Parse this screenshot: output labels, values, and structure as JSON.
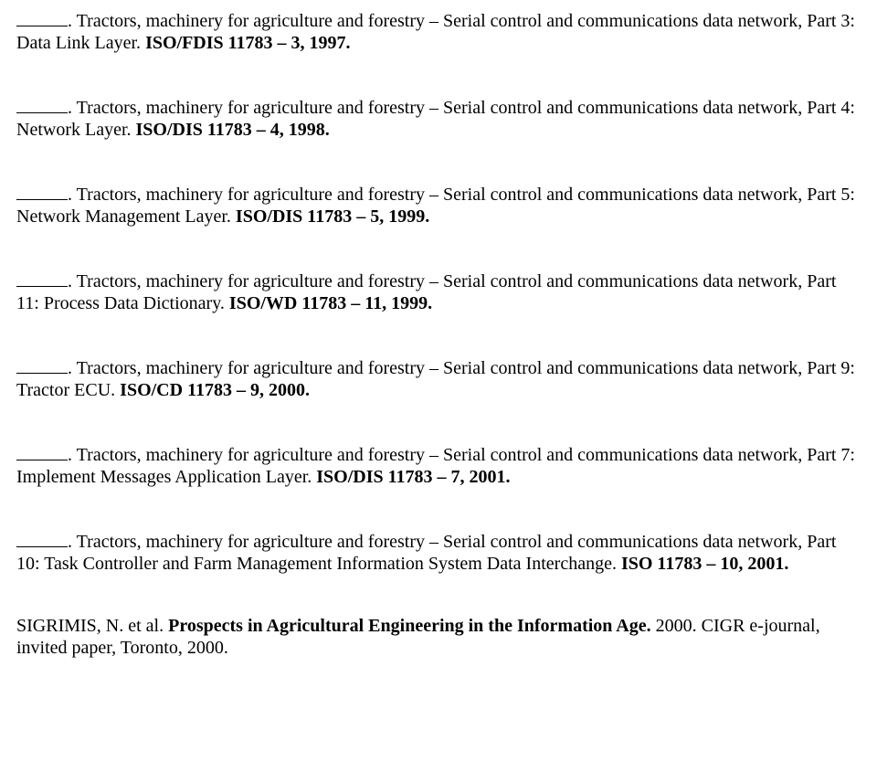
{
  "entries": [
    {
      "title": "Tractors, machinery for agriculture and forestry – Serial control and communications data network, Part 3: Data Link Layer.",
      "code": "ISO/FDIS 11783 – 3, 1997."
    },
    {
      "title": "Tractors, machinery for agriculture and forestry – Serial control and communications data network, Part 4: Network Layer.",
      "code": "ISO/DIS 11783 – 4, 1998."
    },
    {
      "title": "Tractors, machinery for agriculture and forestry – Serial control and communications data network,  Part 5: Network Management Layer.",
      "code": "ISO/DIS 11783 – 5, 1999."
    },
    {
      "title": "Tractors, machinery for agriculture and forestry – Serial control and communications data network, Part 11: Process Data Dictionary.",
      "code": "ISO/WD 11783 – 11, 1999."
    },
    {
      "title": "Tractors, machinery for agriculture and forestry – Serial control and communications data network,  Part 9: Tractor ECU.",
      "code": "ISO/CD 11783 – 9, 2000."
    },
    {
      "title": "Tractors, machinery for agriculture and forestry – Serial control and communications data network, Part 7: Implement Messages Application Layer.",
      "code": "ISO/DIS 11783 – 7, 2001."
    },
    {
      "title": "Tractors, machinery for agriculture and forestry – Serial control and communications data network, Part 10: Task Controller and Farm Management Information System Data Interchange.",
      "code": "ISO 11783 – 10, 2001."
    }
  ],
  "final": {
    "author": "SIGRIMIS, N. et al.",
    "title": "Prospects in Agricultural Engineering in the Information Age.",
    "rest": "  2000.  CIGR e-journal, invited paper, Toronto, 2000."
  }
}
